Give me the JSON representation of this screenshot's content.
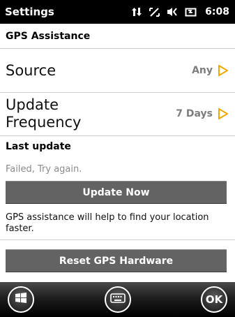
{
  "statusbar": {
    "title": "Settings",
    "time": "6:08",
    "icons": [
      "data-connection-icon",
      "network-icon",
      "speaker-muted-icon",
      "battery-charging-icon"
    ]
  },
  "page": {
    "section_title": "GPS Assistance"
  },
  "rows": [
    {
      "label": "Source",
      "value": "Any"
    },
    {
      "label_line1": "Update",
      "label_line2": "Frequency",
      "value": "7 Days"
    }
  ],
  "last_update": {
    "heading": "Last update",
    "status": "Failed, Try again."
  },
  "buttons": {
    "update_now": "Update Now",
    "reset_hardware": "Reset GPS Hardware"
  },
  "info": {
    "text": "GPS assistance will help to find your location faster."
  },
  "softkeys": {
    "left": "start-icon",
    "center": "keyboard-icon",
    "right_label": "OK"
  },
  "colors": {
    "accent_arrow": "#f5a500",
    "button_bg": "#636363",
    "muted_text": "#8a8a8a"
  }
}
